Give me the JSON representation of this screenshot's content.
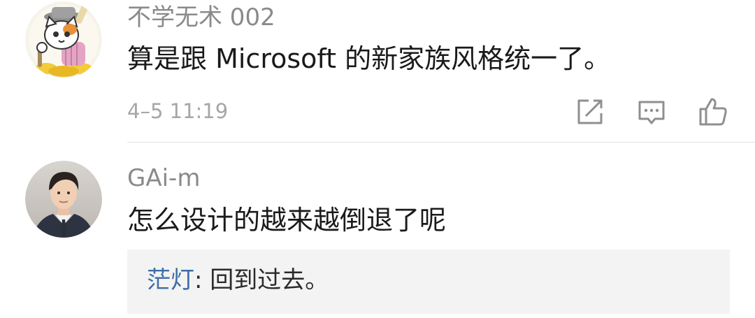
{
  "comments": [
    {
      "username": "不学无术 002",
      "text": "算是跟 Microsoft 的新家族风格统一了。",
      "timestamp": "4–5 11:19",
      "avatar_icon": "cartoon-cat-avatar",
      "actions": [
        "share-icon",
        "comment-icon",
        "like-icon"
      ]
    },
    {
      "username": "GAi-m",
      "text": "怎么设计的越来越倒退了呢",
      "avatar_icon": "person-photo-avatar",
      "reply": {
        "author": "茫灯",
        "separator": ": ",
        "text": "回到过去。"
      }
    }
  ],
  "colors": {
    "username": "#8a8a8a",
    "text": "#1a1a1a",
    "timestamp": "#a6a6a6",
    "reply_author": "#3c6ea6",
    "reply_bg": "#f3f3f3"
  }
}
